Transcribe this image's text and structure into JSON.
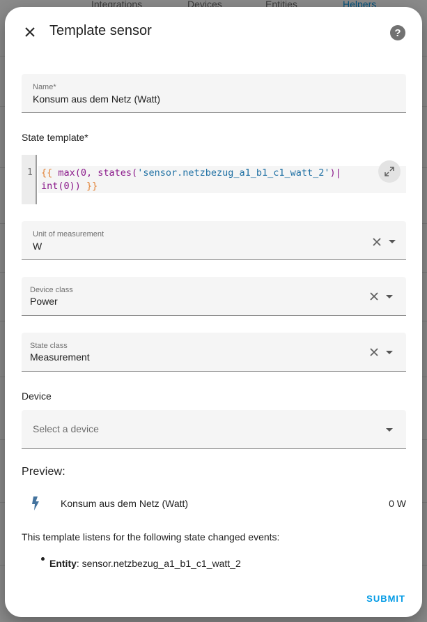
{
  "background": {
    "tabs": [
      "Integrations",
      "Devices",
      "Entities",
      "Helpers"
    ]
  },
  "dialog": {
    "title": "Template sensor",
    "close_icon": "close-icon",
    "help_icon": "help-circle-icon"
  },
  "form": {
    "name": {
      "label": "Name*",
      "value": "Konsum aus dem Netz (Watt)"
    },
    "state_template": {
      "label": "State template*",
      "line_number": "1",
      "code_line1_a": "{{ ",
      "code_line1_b": "max(0, states(",
      "code_line1_c": "'sensor.netzbezug_a1_b1_c1_watt_2'",
      "code_line1_d": ")|",
      "code_line2_a": "int(0)) ",
      "code_line2_b": "}}"
    },
    "unit_of_measurement": {
      "label": "Unit of measurement",
      "value": "W"
    },
    "device_class": {
      "label": "Device class",
      "value": "Power"
    },
    "state_class": {
      "label": "State class",
      "value": "Measurement"
    },
    "device": {
      "section_label": "Device",
      "placeholder": "Select a device"
    }
  },
  "preview": {
    "title": "Preview:",
    "icon": "flash-icon",
    "entity_name": "Konsum aus dem Netz (Watt)",
    "value": "0 W",
    "listen_text": "This template listens for the following state changed events:",
    "entity_label": "Entity",
    "entity_id": ": sensor.netzbezug_a1_b1_c1_watt_2"
  },
  "actions": {
    "submit_label": "SUBMIT"
  },
  "colors": {
    "accent": "#039be5",
    "flash": "#44739e"
  }
}
